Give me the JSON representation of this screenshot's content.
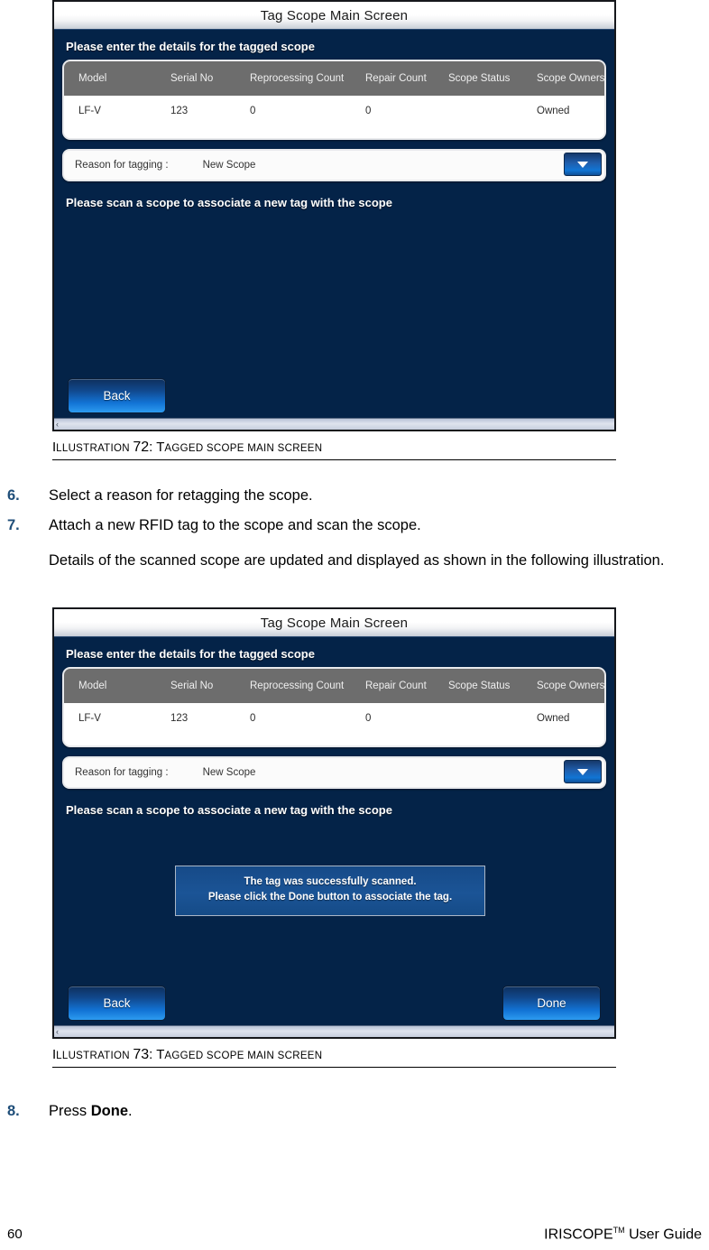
{
  "page": {
    "number": "60",
    "guide_title": "IRISCOPE",
    "guide_tm": "TM",
    "guide_suffix": " User Guide"
  },
  "steps": [
    {
      "num": "6.",
      "text": "Select a reason for retagging the scope."
    },
    {
      "num": "7.",
      "text": "Attach a new RFID tag to the scope and scan the scope."
    },
    {
      "num": "8.",
      "text_prefix": "Press ",
      "text_bold": "Done",
      "text_suffix": "."
    }
  ],
  "paragraphs": {
    "after_step7": "Details of the scanned scope are updated and displayed as shown in the following illustration."
  },
  "captions": {
    "figure1": {
      "lead": "I",
      "lead_rest": "LLUSTRATION ",
      "number": "72",
      "colon": ": ",
      "title_cap": "T",
      "title_rest": "AGGED SCOPE MAIN SCREEN"
    },
    "figure2": {
      "lead": "I",
      "lead_rest": "LLUSTRATION ",
      "number": "73",
      "colon": ": ",
      "title_cap": "T",
      "title_rest": "AGGED SCOPE MAIN SCREEN"
    }
  },
  "screen": {
    "title": "Tag Scope Main Screen",
    "section_heading": "Please enter the details for the tagged scope",
    "table": {
      "headers": [
        "Model",
        "Serial No",
        "Reprocessing Count",
        "Repair Count",
        "Scope Status",
        "Scope Ownership"
      ],
      "rows": [
        {
          "model": "LF-V",
          "serial_no": "123",
          "reprocessing_count": "0",
          "repair_count": "0",
          "scope_status": "",
          "scope_ownership": "Owned"
        }
      ]
    },
    "dropdown": {
      "label": "Reason for tagging :",
      "value": "New Scope",
      "arrow_icon": "chevron-down-icon"
    },
    "scan_prompt": "Please scan a scope to associate a new tag with the scope",
    "buttons": {
      "back": "Back",
      "done": "Done"
    },
    "message_box": {
      "line1": "The tag was successfully scanned.",
      "line2": "Please click the Done button to associate the tag."
    },
    "scrollbar": {
      "left_arrow": "‹"
    }
  },
  "colors": {
    "screen_background": "#042348",
    "table_header": "#6d6d6d",
    "button_blue": "#1274d6",
    "step_number": "#1f4e79",
    "message_box": "#1b5496"
  }
}
